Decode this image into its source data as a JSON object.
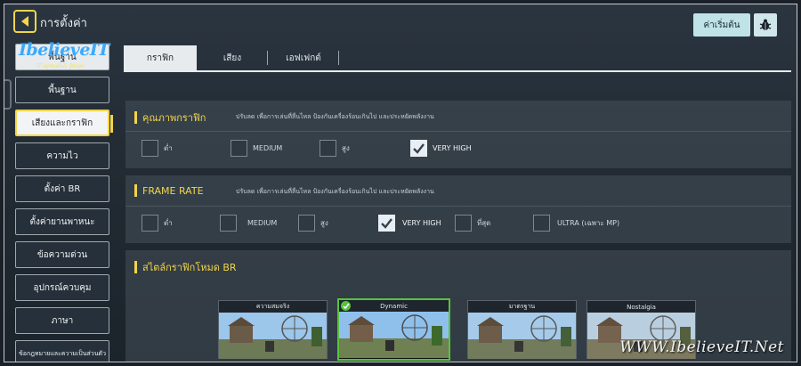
{
  "header": {
    "title": "การตั้งค่า",
    "reset_label": "ค่าเริ่มต้น"
  },
  "logo": {
    "text": "IbelieveIT",
    "tagline": "IT อยู่รอบตัว & รู้ทันยุค"
  },
  "sidebar": {
    "items": [
      {
        "label": "พื้นฐาน"
      },
      {
        "label": "พื้นฐาน"
      },
      {
        "label": "เสียงและกราฟิก"
      },
      {
        "label": "ความไว"
      },
      {
        "label": "ตั้งค่า BR"
      },
      {
        "label": "ตั้งค่ายานพาหนะ"
      },
      {
        "label": "ข้อความด่วน"
      },
      {
        "label": "อุปกรณ์ควบคุม"
      },
      {
        "label": "ภาษา"
      },
      {
        "label": "ข้อกฎหมายและความเป็นส่วนตัว"
      }
    ]
  },
  "tabs": [
    {
      "label": "กราฟิก"
    },
    {
      "label": "เสียง"
    },
    {
      "label": "เอฟเฟกต์"
    }
  ],
  "quality": {
    "title": "คุณภาพกราฟิก",
    "desc": "ปรับลด เพื่อการเล่นที่ลื่นไหล ป้องกันเครื่องร้อนเกินไป และประหยัดพลังงาน",
    "options": [
      {
        "label": "ต่ำ",
        "checked": false
      },
      {
        "label": "MEDIUM",
        "checked": false
      },
      {
        "label": "สูง",
        "checked": false
      },
      {
        "label": "VERY HIGH",
        "checked": true
      }
    ]
  },
  "framerate": {
    "title": "FRAME RATE",
    "desc": "ปรับลด เพื่อการเล่นที่ลื่นไหล ป้องกันเครื่องร้อนเกินไป และประหยัดพลังงาน",
    "options": [
      {
        "label": "ต่ำ",
        "checked": false
      },
      {
        "label": "MEDIUM",
        "checked": false
      },
      {
        "label": "สูง",
        "checked": false
      },
      {
        "label": "VERY HIGH",
        "checked": true
      },
      {
        "label": "ที่สุด",
        "checked": false
      },
      {
        "label": "ULTRA (เฉพาะ MP)",
        "checked": false
      }
    ]
  },
  "br_style": {
    "title": "สไตล์กราฟิกโหมด BR",
    "styles": [
      {
        "label": "ความสมจริง",
        "selected": false
      },
      {
        "label": "Dynamic",
        "selected": true
      },
      {
        "label": "มาตรฐาน",
        "selected": false
      },
      {
        "label": "Nostalgia",
        "selected": false
      }
    ]
  },
  "watermark": "WWW.IbelieveIT.Net",
  "colors": {
    "accent": "#f1d54b",
    "selected_green": "#57c33d",
    "reset_button": "#bfe3e6"
  }
}
